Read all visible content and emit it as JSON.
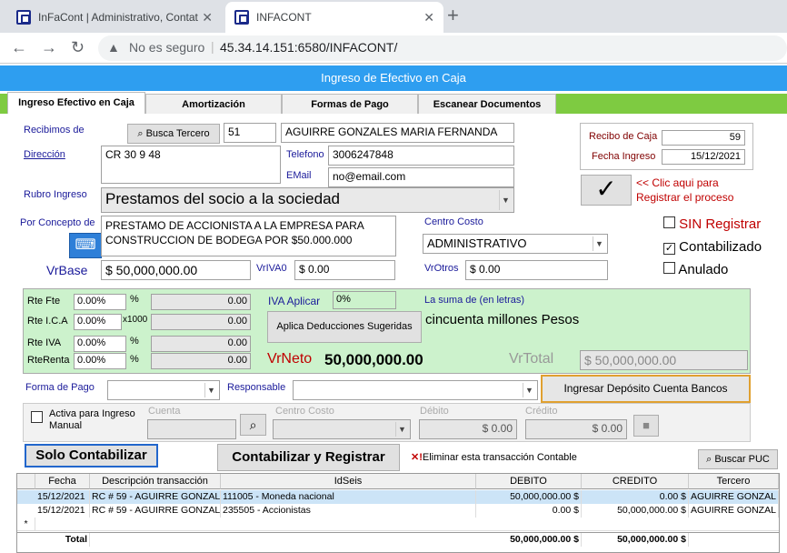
{
  "browser": {
    "tab1": "InFaCont | Administrativo, Contat",
    "tab2": "INFACONT",
    "close": "✕",
    "newtab": "+",
    "insecure": "No es seguro",
    "url": "45.34.14.151:6580/INFACONT/",
    "separator": "|"
  },
  "app": {
    "title": "Ingreso de Efectivo en Caja",
    "tabs": [
      "Ingreso Efectivo en Caja",
      "Amortización",
      "Formas de Pago",
      "Escanear Documentos"
    ]
  },
  "form": {
    "recibimos_label": "Recibimos de",
    "buscar_tercero": "Busca Tercero",
    "tercero_code": "51",
    "tercero_name": "AGUIRRE GONZALES MARIA FERNANDA",
    "direccion_label": "Dirección",
    "direccion": "CR 30 9 48",
    "telefono_label": "Telefono",
    "telefono": "3006247848",
    "email_label": "EMail",
    "email": "no@email.com",
    "rubro_label": "Rubro Ingreso",
    "rubro": "Prestamos del socio a la sociedad",
    "concepto_label": "Por Concepto de",
    "concepto": "PRESTAMO DE ACCIONISTA A LA EMPRESA PARA CONSTRUCCION DE BODEGA POR $50.000.000",
    "centro_label": "Centro Costo",
    "centro": "ADMINISTRATIVO",
    "vrbase_label": "VrBase",
    "vrbase": "$ 50,000,000.00",
    "vriva0_label": "VrIVA0",
    "vriva0": "$ 0.00",
    "vrotros_label": "VrOtros",
    "vrotros": "$ 0.00",
    "recibo_label": "Recibo de Caja",
    "recibo": "59",
    "fecha_label": "Fecha Ingreso",
    "fecha": "15/12/2021",
    "registrar_hint": "<< Clic aqui para Registrar el proceso",
    "sin_registrar": "SIN Registrar",
    "contabilizado": "Contabilizado",
    "anulado": "Anulado"
  },
  "retenciones": {
    "rtefte_label": "Rte Fte",
    "rtefte_pct": "0.00%",
    "rtefte_val": "0.00",
    "pct": "%",
    "rteica_label": "Rte I.C.A",
    "rteica_pct": "0.00%",
    "x1000": "x1000",
    "rteica_val": "0.00",
    "rteiva_label": "Rte IVA",
    "rteiva_pct": "0.00%",
    "rteiva_val": "0.00",
    "rterenta_label": "RteRenta",
    "rterenta_pct": "0.00%",
    "rterenta_val": "0.00",
    "iva_aplicar_label": "IVA Aplicar",
    "iva_aplicar": "0%",
    "suma_label": "La suma de (en letras)",
    "suma": "cincuenta millones Pesos",
    "aplica_btn": "Aplica Deducciones Sugeridas",
    "vrneto_label": "VrNeto",
    "vrneto": "50,000,000.00",
    "vrtotal_label": "VrTotal",
    "vrtotal": "$ 50,000,000.00"
  },
  "pago": {
    "forma_label": "Forma de Pago",
    "responsable_label": "Responsable",
    "ingresar_btn": "Ingresar Depósito Cuenta Bancos"
  },
  "manual": {
    "activa_label": "Activa para Ingreso Manual",
    "cuenta_label": "Cuenta",
    "centro_label": "Centro Costo",
    "debito_label": "Débito",
    "debito": "$ 0.00",
    "credito_label": "Crédito",
    "credito": "$ 0.00"
  },
  "actions": {
    "solo": "Solo Contabilizar",
    "contab_reg": "Contabilizar y Registrar",
    "eliminar": "Eliminar esta transacción Contable",
    "buscar_puc": "Buscar PUC"
  },
  "grid": {
    "headers": [
      "Fecha",
      "Descripción transacción",
      "IdSeis",
      "DEBITO",
      "CREDITO",
      "Tercero"
    ],
    "rows": [
      [
        "15/12/2021",
        "RC # 59 - AGUIRRE GONZAL",
        "111005 - Moneda nacional",
        "50,000,000.00 $",
        "0.00 $",
        "AGUIRRE GONZAL"
      ],
      [
        "15/12/2021",
        "RC # 59 - AGUIRRE GONZAL",
        "235505 - Accionistas",
        "0.00 $",
        "50,000,000.00 $",
        "AGUIRRE GONZAL"
      ]
    ],
    "new_row_marker": "*",
    "total_label": "Total",
    "total_debito": "50,000,000.00 $",
    "total_credito": "50,000,000.00 $"
  }
}
